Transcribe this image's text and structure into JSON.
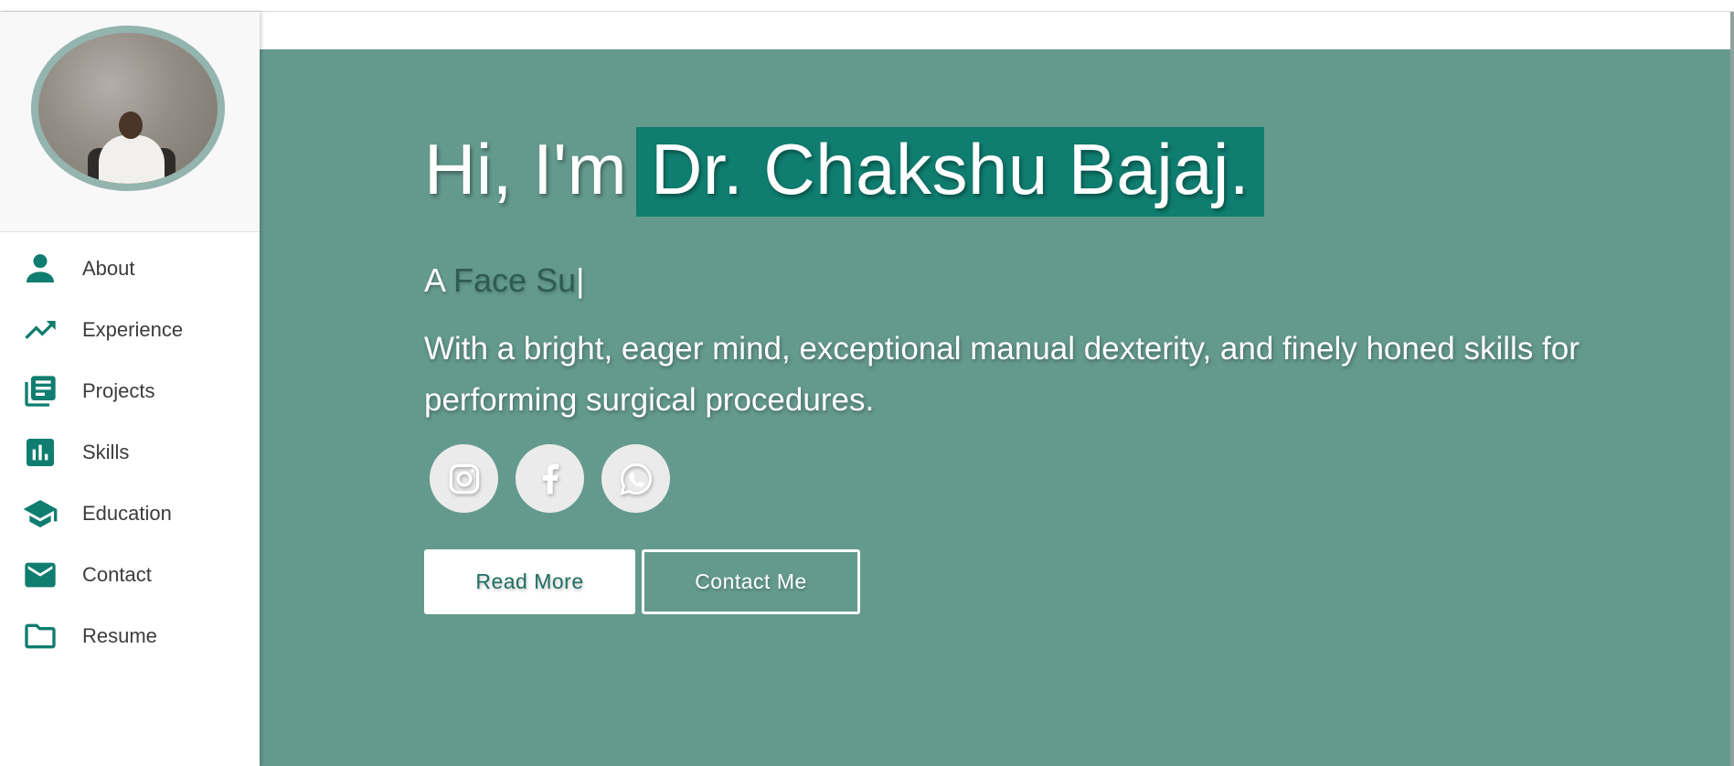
{
  "sidebar": {
    "avatar_alt": "Profile photo",
    "items": [
      {
        "label": "About",
        "icon": "person-icon"
      },
      {
        "label": "Experience",
        "icon": "trending-up-icon"
      },
      {
        "label": "Projects",
        "icon": "library-books-icon"
      },
      {
        "label": "Skills",
        "icon": "bar-chart-icon"
      },
      {
        "label": "Education",
        "icon": "school-icon"
      },
      {
        "label": "Contact",
        "icon": "mail-icon"
      },
      {
        "label": "Resume",
        "icon": "folder-icon"
      }
    ]
  },
  "hero": {
    "greeting": "Hi, I'm",
    "name": "Dr. Chakshu Bajaj.",
    "subtitle_prefix": "A",
    "subtitle_typed": "Face Su",
    "cursor": "|",
    "description": "With a bright, eager mind, exceptional manual dexterity, and finely honed skills for performing surgical procedures.",
    "socials": [
      {
        "name": "instagram-icon"
      },
      {
        "name": "facebook-icon"
      },
      {
        "name": "whatsapp-icon"
      }
    ],
    "read_more_label": "Read More",
    "contact_me_label": "Contact Me"
  },
  "colors": {
    "accent": "#0f7d6f",
    "hero_bg": "#649a8d",
    "avatar_ring": "#94b4ae",
    "social_bg": "#ebebeb"
  }
}
